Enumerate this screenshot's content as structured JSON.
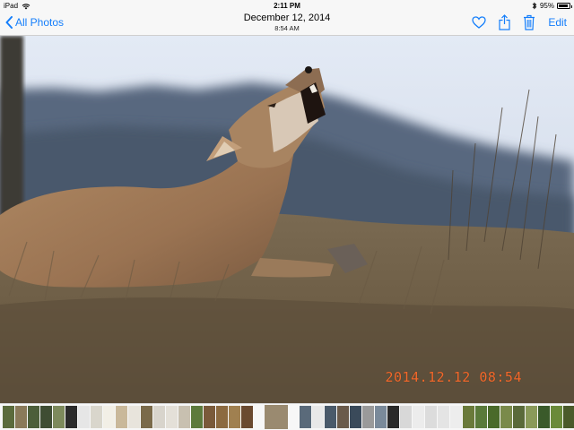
{
  "status_bar": {
    "device": "iPad",
    "time": "2:11 PM",
    "battery_percent": "95%",
    "battery_level": 0.95,
    "wifi_icon": "wifi-icon",
    "bluetooth_icon": "bluetooth-icon"
  },
  "nav": {
    "back_label": "All Photos",
    "date": "December 12, 2014",
    "time": "8:54 AM",
    "edit_label": "Edit",
    "icons": [
      "heart-icon",
      "share-icon",
      "trash-icon"
    ]
  },
  "photo": {
    "subject": "coyote-howling",
    "timestamp_overlay": "2014.12.12 08:54"
  },
  "colors": {
    "accent": "#147efb",
    "timestamp": "#f3682a",
    "bar_bg": "#f7f7f7"
  },
  "thumbnails": {
    "before": [
      "#5b6b3c",
      "#8a7a5a",
      "#4c5e3a",
      "#3f4d33",
      "#7d8a5c",
      "#2b2b2b",
      "#e6e6e6",
      "#d9d6cc",
      "#f2efe6",
      "#c9b89a",
      "#e8e4dc",
      "#7a6a4a",
      "#d8d4cc",
      "#e4e0d8",
      "#c8c0b0",
      "#5d7a3c",
      "#7a5a3a",
      "#8c6a40",
      "#a08050",
      "#6a4a30"
    ],
    "current": "#9a8a70",
    "after": [
      "#5a6a7a",
      "#e8e8e8",
      "#4a5a6a",
      "#6a5a4a",
      "#3a4a5a",
      "#9a9a9a",
      "#7a8a9a",
      "#2a2a2a",
      "#d8d8d8",
      "#ececec",
      "#dcdcdc",
      "#e4e4e4",
      "#ededed",
      "#6a7a3a",
      "#5a7a3a",
      "#4a6a2a",
      "#7a8a4a",
      "#5a6a3a",
      "#8a9a5a",
      "#3a5a2a",
      "#6a8a3a",
      "#4a5a2a"
    ]
  }
}
